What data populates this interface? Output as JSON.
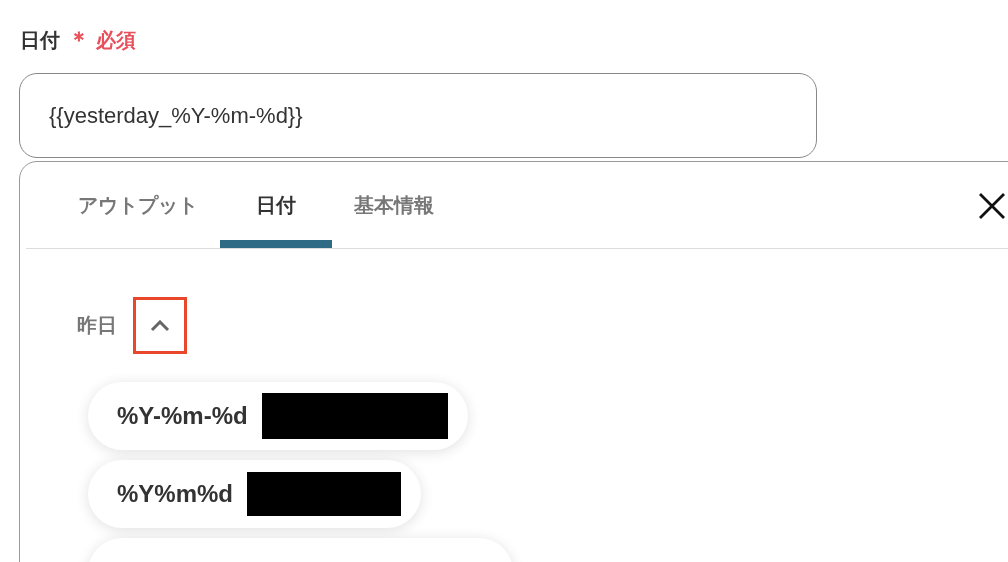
{
  "field": {
    "label": "日付",
    "required_mark": "＊",
    "required_text": "必須",
    "value": "{{yesterday_%Y-%m-%d}}"
  },
  "panel": {
    "tabs": [
      {
        "label": "アウトプット",
        "selected": false
      },
      {
        "label": "日付",
        "selected": true
      },
      {
        "label": "基本情報",
        "selected": false
      }
    ],
    "section": {
      "title": "昨日",
      "expanded": true,
      "items": [
        {
          "label": "%Y-%m-%d"
        },
        {
          "label": "%Y%m%d"
        }
      ]
    }
  }
}
